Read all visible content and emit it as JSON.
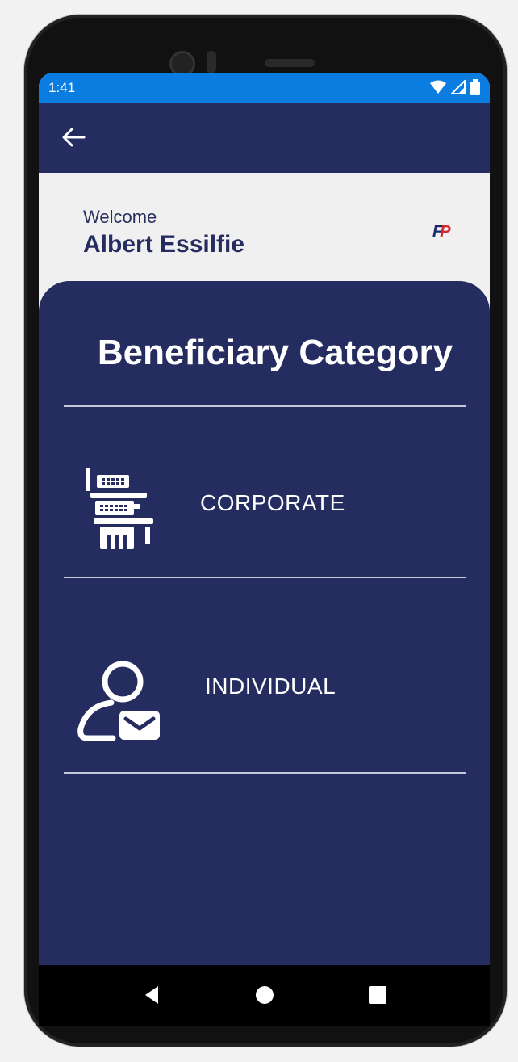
{
  "status_bar": {
    "time": "1:41"
  },
  "header": {
    "welcome_label": "Welcome",
    "user_name": "Albert Essilfie"
  },
  "logo": {
    "part1": "F",
    "part2": "P"
  },
  "panel": {
    "title": "Beneficiary Category",
    "options": [
      {
        "label": "CORPORATE",
        "icon": "building-icon"
      },
      {
        "label": "INDIVIDUAL",
        "icon": "user-mail-icon"
      }
    ]
  },
  "colors": {
    "status_bar": "#0b7de0",
    "primary": "#252d60",
    "background": "#f0f0f0",
    "divider": "#c5c8d8"
  }
}
